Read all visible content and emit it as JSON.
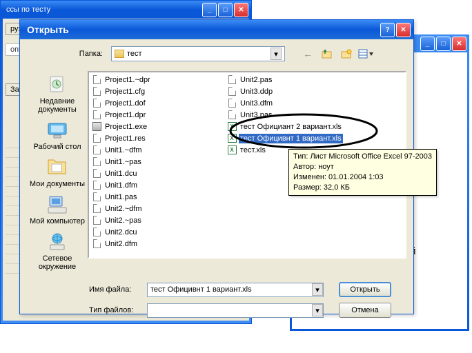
{
  "parent_window": {
    "title": "ссы по тесту",
    "load_button": "рузить с",
    "tab_opr": "опр",
    "load2": "Загр"
  },
  "bg_window2": {
    "text": "мый"
  },
  "dialog": {
    "title": "Открыть",
    "folder_label": "Папка:",
    "folder_value": "тест",
    "filename_label": "Имя файла:",
    "filename_value": "тест Официвнт 1 вариант.xls",
    "filetype_label": "Тип файлов:",
    "filetype_value": "",
    "open_button": "Открыть",
    "cancel_button": "Отмена"
  },
  "sidebar": [
    {
      "id": "recent",
      "label": "Недавние документы"
    },
    {
      "id": "desktop",
      "label": "Рабочий стол"
    },
    {
      "id": "mydocs",
      "label": "Мои документы"
    },
    {
      "id": "mycomp",
      "label": "Мой компьютер"
    },
    {
      "id": "network",
      "label": "Сетевое окружение"
    }
  ],
  "files": [
    {
      "name": "Project1.~dpr",
      "type": "generic",
      "selected": false
    },
    {
      "name": "Project1.cfg",
      "type": "generic",
      "selected": false
    },
    {
      "name": "Project1.dof",
      "type": "generic",
      "selected": false
    },
    {
      "name": "Project1.dpr",
      "type": "generic",
      "selected": false
    },
    {
      "name": "Project1.exe",
      "type": "exe",
      "selected": false
    },
    {
      "name": "Project1.res",
      "type": "generic",
      "selected": false
    },
    {
      "name": "Unit1.~dfm",
      "type": "generic",
      "selected": false
    },
    {
      "name": "Unit1.~pas",
      "type": "generic",
      "selected": false
    },
    {
      "name": "Unit1.dcu",
      "type": "generic",
      "selected": false
    },
    {
      "name": "Unit1.dfm",
      "type": "generic",
      "selected": false
    },
    {
      "name": "Unit1.pas",
      "type": "generic",
      "selected": false
    },
    {
      "name": "Unit2.~dfm",
      "type": "generic",
      "selected": false
    },
    {
      "name": "Unit2.~pas",
      "type": "generic",
      "selected": false
    },
    {
      "name": "Unit2.dcu",
      "type": "generic",
      "selected": false
    },
    {
      "name": "Unit2.dfm",
      "type": "generic",
      "selected": false
    },
    {
      "name": "Unit2.pas",
      "type": "generic",
      "selected": false
    },
    {
      "name": "Unit3.ddp",
      "type": "generic",
      "selected": false
    },
    {
      "name": "Unit3.dfm",
      "type": "generic",
      "selected": false
    },
    {
      "name": "Unit3.pas",
      "type": "generic",
      "selected": false
    },
    {
      "name": "тест Официант 2 вариант.xls",
      "type": "excel",
      "selected": false
    },
    {
      "name": "тест Официвнт 1 вариант.xls",
      "type": "excel",
      "selected": true
    },
    {
      "name": "тест.xls",
      "type": "excel",
      "selected": false
    }
  ],
  "tooltip": {
    "line1": "Тип: Лист Microsoft Office Excel 97-2003",
    "line2": "Автор: ноут",
    "line3": "Изменен: 01.01.2004 1:03",
    "line4": "Размер: 32,0 КБ"
  }
}
